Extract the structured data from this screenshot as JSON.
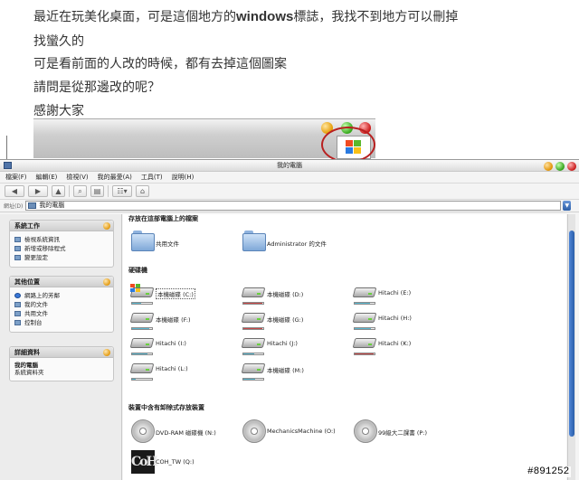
{
  "post": {
    "lines": [
      {
        "before": "最近在玩美化桌面，可是這個地方的",
        "latin": "windows",
        "after": "標誌，我找不到地方可以刪掉"
      },
      {
        "before": "找蠻久的",
        "latin": "",
        "after": ""
      },
      {
        "before": "可是看前面的人改的時候，都有去掉這個圖案",
        "latin": "",
        "after": ""
      },
      {
        "before": "請問是從那邊改的呢？",
        "latin": "",
        "after": ""
      },
      {
        "before": "感謝大家",
        "latin": "",
        "after": ""
      }
    ]
  },
  "window": {
    "title": "我的電腦",
    "menu": [
      "檔案(F)",
      "編輯(E)",
      "檢視(V)",
      "我的最愛(A)",
      "工具(T)",
      "說明(H)"
    ],
    "address_label": "網址(D)",
    "address_value": "我的電腦"
  },
  "tasks": {
    "system": {
      "title": "系統工作",
      "items": [
        "檢視系統資訊",
        "新增或移除程式",
        "變更設定"
      ]
    },
    "other": {
      "title": "其他位置",
      "items": [
        "網路上的芳鄰",
        "我的文件",
        "共用文件",
        "控制台"
      ]
    },
    "details": {
      "title": "詳細資料",
      "name": "我的電腦",
      "desc": "系統資料夾"
    }
  },
  "sections": {
    "stored": "存放在這部電腦上的檔案",
    "harddrives": "硬碟機",
    "removable": "裝置中含有卸除式存放裝置"
  },
  "folders": [
    {
      "label": "共用文件"
    },
    {
      "label": "Administrator 的文件"
    }
  ],
  "drives": [
    {
      "label": "本機磁碟 (C:)",
      "used": 0.45,
      "color": "#5ab8d0",
      "system": true,
      "selected": true
    },
    {
      "label": "本機磁碟 (D:)",
      "used": 0.95,
      "color": "#c84848",
      "system": false,
      "selected": false
    },
    {
      "label": "Hitachi (E:)",
      "used": 0.75,
      "color": "#5ab8d0",
      "system": false,
      "selected": false
    },
    {
      "label": "本機磁碟 (F:)",
      "used": 0.85,
      "color": "#5ab8d0",
      "system": false,
      "selected": false
    },
    {
      "label": "本機磁碟 (G:)",
      "used": 0.95,
      "color": "#c84848",
      "system": false,
      "selected": false
    },
    {
      "label": "Hitachi (H:)",
      "used": 0.8,
      "color": "#5ab8d0",
      "system": false,
      "selected": false
    },
    {
      "label": "Hitachi (I:)",
      "used": 0.75,
      "color": "#5ab8d0",
      "system": false,
      "selected": false
    },
    {
      "label": "Hitachi (J:)",
      "used": 0.55,
      "color": "#5ab8d0",
      "system": false,
      "selected": false
    },
    {
      "label": "Hitachi (K:)",
      "used": 0.95,
      "color": "#c84848",
      "system": false,
      "selected": false
    },
    {
      "label": "Hitachi (L:)",
      "used": 0.2,
      "color": "#5ab8d0",
      "system": false,
      "selected": false
    },
    {
      "label": "本機磁碟 (M:)",
      "used": 0.6,
      "color": "#5ab8d0",
      "system": false,
      "selected": false
    }
  ],
  "removable": [
    {
      "label": "DVD-RAM 磁碟機 (N:)",
      "kind": "cd-icon"
    },
    {
      "label": "MechanicsMachine (O:)",
      "kind": "cd-icon"
    },
    {
      "label": "99級大二課書 (P:)",
      "kind": "cd-icon"
    },
    {
      "label": "COH_TW (Q:)",
      "kind": "coh-logo",
      "logo_text": "CoH"
    }
  ],
  "stamp": "#891252"
}
